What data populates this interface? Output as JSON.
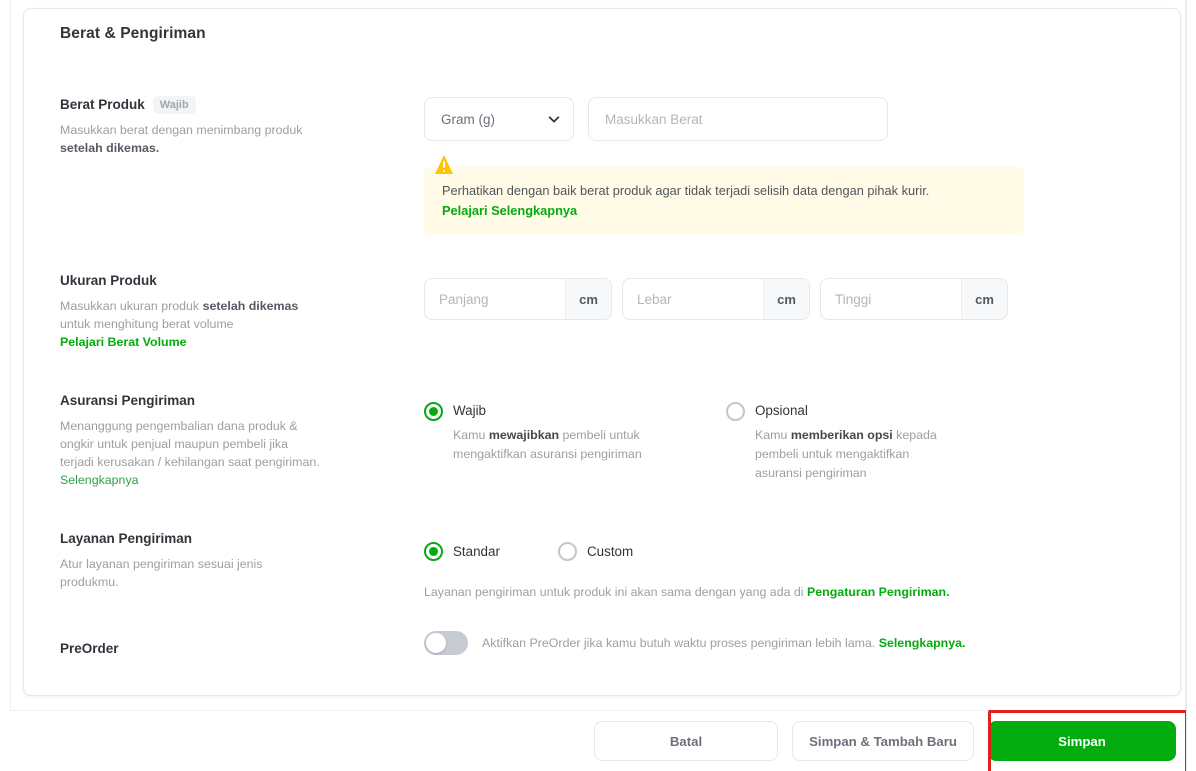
{
  "card": {
    "title": "Berat & Pengiriman"
  },
  "sections": {
    "weight": {
      "label": "Berat Produk",
      "badge": "Wajib",
      "desc_plain": "Masukkan berat dengan menimbang produk ",
      "desc_bold": "setelah dikemas.",
      "unit_select_value": "Gram (g)",
      "unit_select_icon": "chevron-down-icon",
      "weight_placeholder": "Masukkan Berat",
      "alert_icon": "warning-triangle-icon",
      "alert_text": "Perhatikan dengan baik berat produk agar tidak terjadi selisih data dengan pihak kurir.",
      "alert_link": "Pelajari Selengkapnya"
    },
    "size": {
      "label": "Ukuran Produk",
      "desc_1": "Masukkan ukuran produk ",
      "desc_1_bold": "setelah dikemas",
      "desc_2": "untuk menghitung berat volume",
      "link": "Pelajari Berat Volume",
      "fields": [
        {
          "placeholder": "Panjang",
          "unit": "cm"
        },
        {
          "placeholder": "Lebar",
          "unit": "cm"
        },
        {
          "placeholder": "Tinggi",
          "unit": "cm"
        }
      ]
    },
    "insurance": {
      "label": "Asuransi Pengiriman",
      "desc": "Menanggung pengembalian dana produk & ongkir untuk penjual maupun pembeli jika terjadi kerusakan / kehilangan saat pengiriman. ",
      "desc_link": "Selengkapnya",
      "options": [
        {
          "label": "Wajib",
          "selected": true,
          "sub_pre": "Kamu ",
          "sub_bold": "mewajibkan",
          "sub_post": " pembeli untuk mengaktifkan asuransi pengiriman"
        },
        {
          "label": "Opsional",
          "selected": false,
          "sub_pre": "Kamu ",
          "sub_bold": "memberikan opsi",
          "sub_post": " kepada pembeli untuk mengaktifkan asuransi pengiriman"
        }
      ]
    },
    "service": {
      "label": "Layanan Pengiriman",
      "desc": "Atur layanan pengiriman sesuai jenis produkmu.",
      "options": [
        {
          "label": "Standar",
          "selected": true
        },
        {
          "label": "Custom",
          "selected": false
        }
      ],
      "hint_text": "Layanan pengiriman untuk produk ini akan sama dengan yang ada di ",
      "hint_link": "Pengaturan Pengiriman."
    },
    "preorder": {
      "label": "PreOrder",
      "toggle_state": "off",
      "hint_text": "Aktifkan PreOrder jika kamu butuh waktu proses pengiriman lebih lama. ",
      "hint_link": "Selengkapnya."
    }
  },
  "footer": {
    "cancel_label": "Batal",
    "save_add_label": "Simpan & Tambah Baru",
    "save_label": "Simpan"
  },
  "colors": {
    "brand_green": "#03AC0E",
    "annotation_red": "#E02020",
    "alert_bg": "#FFFBE6",
    "text_dark": "#31353B",
    "text_muted": "#9B9FA6"
  }
}
